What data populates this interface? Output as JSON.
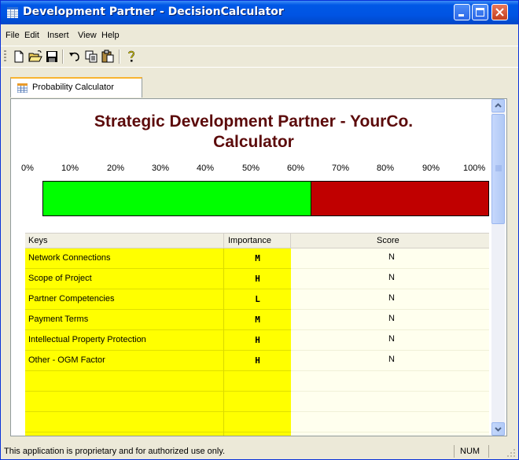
{
  "window": {
    "title": "Development Partner - DecisionCalculator"
  },
  "menu": [
    "File",
    "Edit",
    "Insert",
    "View",
    "Help"
  ],
  "toolbar": {
    "icons": [
      "new-file-icon",
      "open-folder-icon",
      "save-icon",
      "undo-icon",
      "copy-icon",
      "paste-icon",
      "help-icon"
    ]
  },
  "tab": {
    "label": "Probability Calculator"
  },
  "calculator": {
    "heading_line1": "Strategic Development Partner - YourCo.",
    "heading_line2": "Calculator",
    "scale_ticks": [
      "0%",
      "10%",
      "20%",
      "30%",
      "40%",
      "50%",
      "60%",
      "70%",
      "80%",
      "90%",
      "100%"
    ],
    "probability": 0.6,
    "colors": {
      "positive": "#00ff00",
      "negative": "#c00000",
      "heading": "#5c0b0b"
    }
  },
  "grid": {
    "headers": {
      "keys": "Keys",
      "importance": "Importance",
      "score": "Score"
    },
    "rows": [
      {
        "key": "Network Connections",
        "importance": "M",
        "score": "N"
      },
      {
        "key": "Scope of Project",
        "importance": "H",
        "score": "N"
      },
      {
        "key": "Partner Competencies",
        "importance": "L",
        "score": "N"
      },
      {
        "key": "Payment Terms",
        "importance": "M",
        "score": "N"
      },
      {
        "key": "Intellectual Property Protection",
        "importance": "H",
        "score": "N"
      },
      {
        "key": "Other - OGM Factor",
        "importance": "H",
        "score": "N"
      }
    ],
    "empty_rows": 4
  },
  "status": {
    "message": "This application is proprietary and for authorized use only.",
    "num": "NUM"
  }
}
